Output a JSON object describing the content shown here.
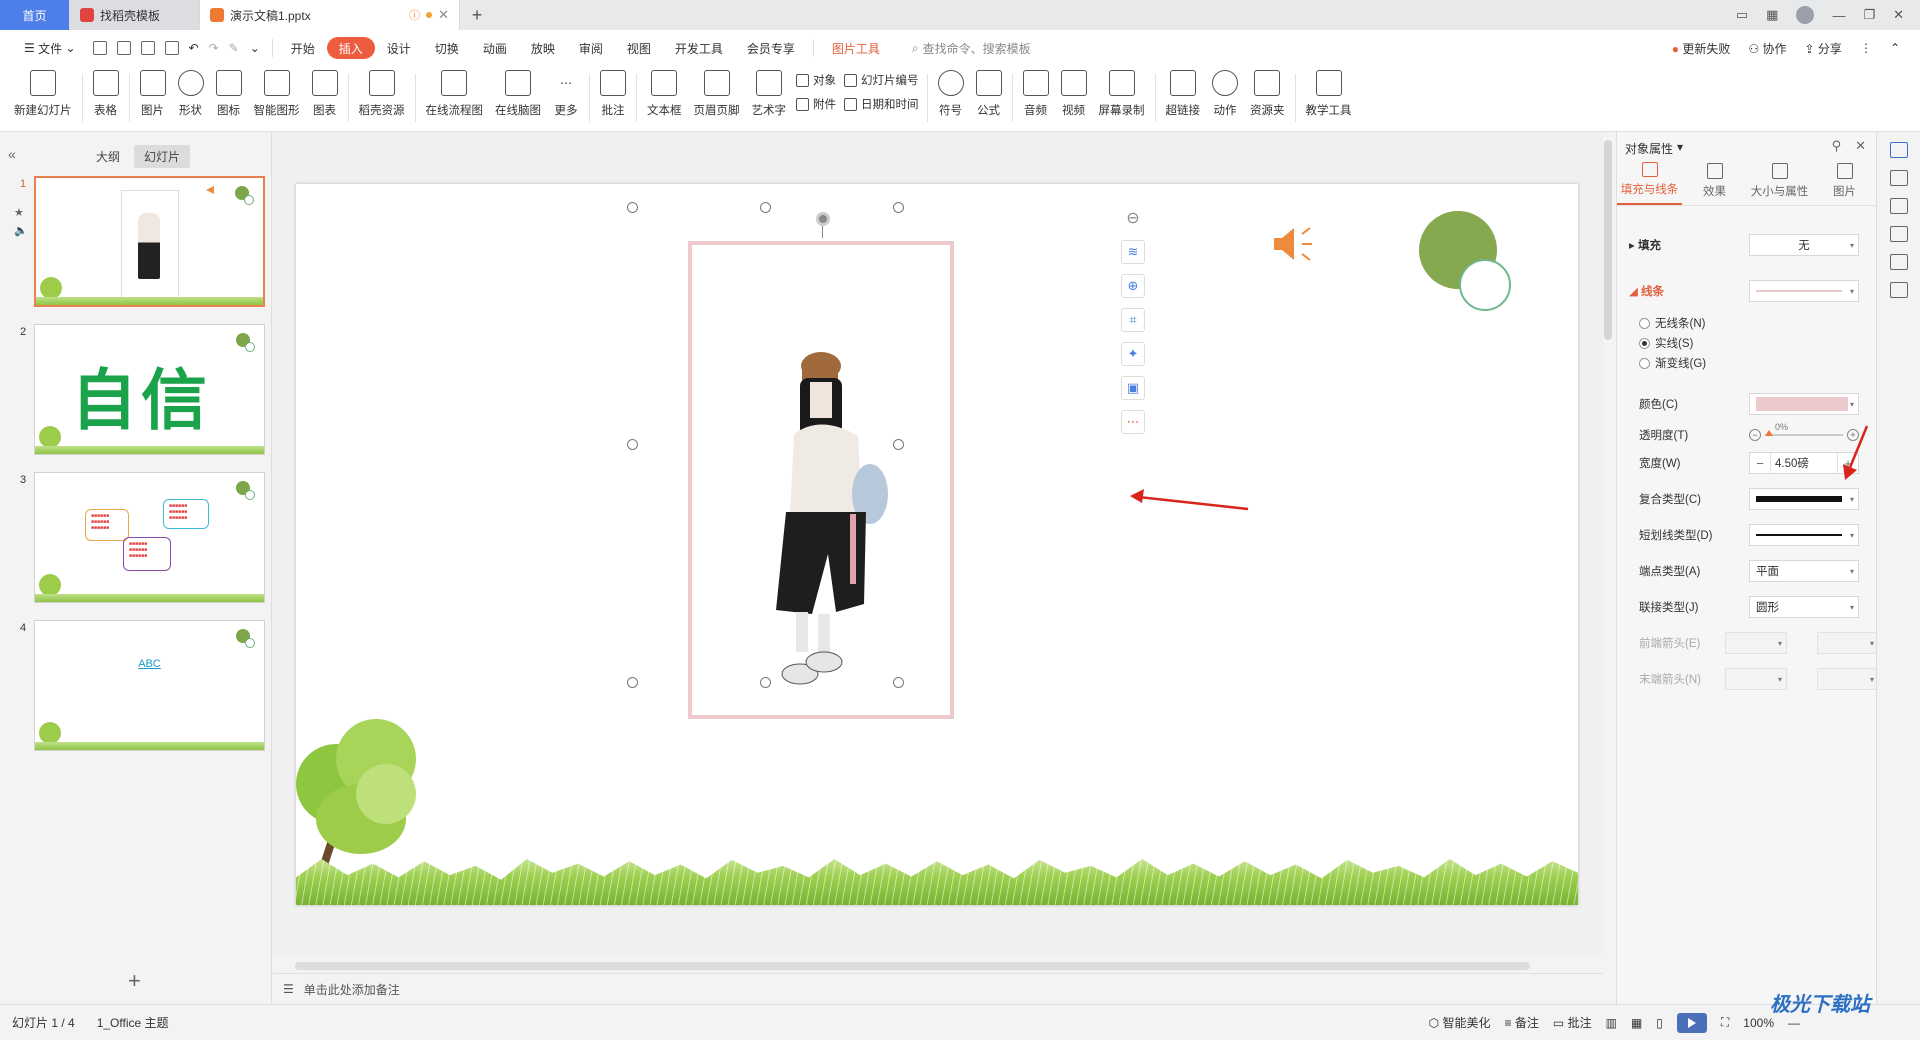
{
  "tabs": {
    "home": "首页",
    "template": "找稻壳模板",
    "document": "演示文稿1.pptx",
    "new_tab": "+"
  },
  "menu": {
    "file": "文件",
    "items": [
      "开始",
      "插入",
      "设计",
      "切换",
      "动画",
      "放映",
      "审阅",
      "视图",
      "开发工具",
      "会员专享"
    ],
    "active": "插入",
    "picture_tools": "图片工具",
    "search_placeholder": "查找命令、搜索模板",
    "update_failed": "更新失败",
    "collaborate": "协作",
    "share": "分享"
  },
  "ribbon": {
    "new_slide": "新建幻灯片",
    "table": "表格",
    "picture": "图片",
    "shape": "形状",
    "icon": "图标",
    "smart_shape": "智能图形",
    "chart": "图表",
    "docer_resource": "稻壳资源",
    "online_flowchart": "在线流程图",
    "online_mindmap": "在线脑图",
    "more": "更多",
    "comment": "批注",
    "textbox": "文本框",
    "header_footer": "页眉页脚",
    "art_text": "艺术字",
    "object": "对象",
    "slide_number": "幻灯片编号",
    "attachment": "附件",
    "date_time": "日期和时间",
    "symbol": "符号",
    "formula": "公式",
    "audio": "音频",
    "video": "视频",
    "screen_record": "屏幕录制",
    "hyperlink": "超链接",
    "action": "动作",
    "resource_folder": "资源夹",
    "teaching_tools": "教学工具"
  },
  "left_pane": {
    "outline_tab": "大纲",
    "slides_tab": "幻灯片",
    "slides": [
      {
        "num": "1"
      },
      {
        "num": "2",
        "text": "自信"
      },
      {
        "num": "3"
      },
      {
        "num": "4",
        "text": "ABC"
      }
    ],
    "add_slide": "+"
  },
  "notes_placeholder": "单击此处添加备注",
  "props": {
    "title": "对象属性",
    "tabs": [
      "填充与线条",
      "效果",
      "大小与属性",
      "图片"
    ],
    "fill_label": "填充",
    "fill_value": "无",
    "line_label": "线条",
    "radio_none": "无线条(N)",
    "radio_solid": "实线(S)",
    "radio_gradient": "渐变线(G)",
    "color_label": "颜色(C)",
    "transparency_label": "透明度(T)",
    "transparency_value": "0%",
    "width_label": "宽度(W)",
    "width_value": "4.50磅",
    "compound_label": "复合类型(C)",
    "dash_label": "短划线类型(D)",
    "cap_label": "端点类型(A)",
    "cap_value": "平面",
    "join_label": "联接类型(J)",
    "join_value": "圆形",
    "begin_arrow_label": "前端箭头(E)",
    "end_arrow_label": "末端箭头(N)",
    "line_color": "#ecc9cb"
  },
  "status": {
    "slide_info": "幻灯片 1 / 4",
    "theme": "1_Office 主题",
    "smart_beautify": "智能美化",
    "notes": "备注",
    "comment": "批注",
    "zoom": "100%"
  },
  "watermark": "极光下载站"
}
